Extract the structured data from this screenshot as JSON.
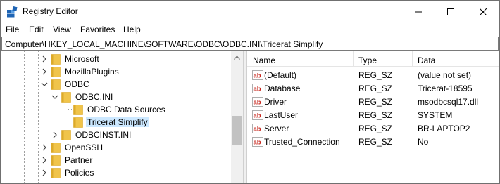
{
  "window": {
    "title": "Registry Editor"
  },
  "menu": [
    "File",
    "Edit",
    "View",
    "Favorites",
    "Help"
  ],
  "address": "Computer\\HKEY_LOCAL_MACHINE\\SOFTWARE\\ODBC\\ODBC.INI\\Tricerat Simplify",
  "tree": {
    "items": [
      {
        "label": "Microsoft",
        "chevron": "right"
      },
      {
        "label": "MozillaPlugins",
        "chevron": "right"
      },
      {
        "label": "ODBC",
        "chevron": "down"
      },
      {
        "label": "ODBC.INI",
        "chevron": "down"
      },
      {
        "label": "ODBC Data Sources",
        "chevron": "none"
      },
      {
        "label": "Tricerat Simplify",
        "chevron": "none",
        "selected": true
      },
      {
        "label": "ODBCINST.INI",
        "chevron": "right"
      },
      {
        "label": "OpenSSH",
        "chevron": "right"
      },
      {
        "label": "Partner",
        "chevron": "right"
      },
      {
        "label": "Policies",
        "chevron": "right"
      }
    ],
    "selection_color": "#cce8ff"
  },
  "list": {
    "columns": [
      "Name",
      "Type",
      "Data"
    ],
    "rows": [
      {
        "name": "(Default)",
        "type": "REG_SZ",
        "data": "(value not set)",
        "icon": "string-value-icon"
      },
      {
        "name": "Database",
        "type": "REG_SZ",
        "data": "Tricerat-18595",
        "icon": "string-value-icon"
      },
      {
        "name": "Driver",
        "type": "REG_SZ",
        "data": "msodbcsql17.dll",
        "icon": "string-value-icon"
      },
      {
        "name": "LastUser",
        "type": "REG_SZ",
        "data": "SYSTEM",
        "icon": "string-value-icon"
      },
      {
        "name": "Server",
        "type": "REG_SZ",
        "data": "BR-LAPTOP2",
        "icon": "string-value-icon"
      },
      {
        "name": "Trusted_Connection",
        "type": "REG_SZ",
        "data": "No",
        "icon": "string-value-icon"
      }
    ]
  },
  "colors": {
    "folder": "#f0c44a",
    "folder_dark": "#dcaa2a",
    "ab_red": "#c8281e",
    "icon_blue": "#1e64b4"
  }
}
